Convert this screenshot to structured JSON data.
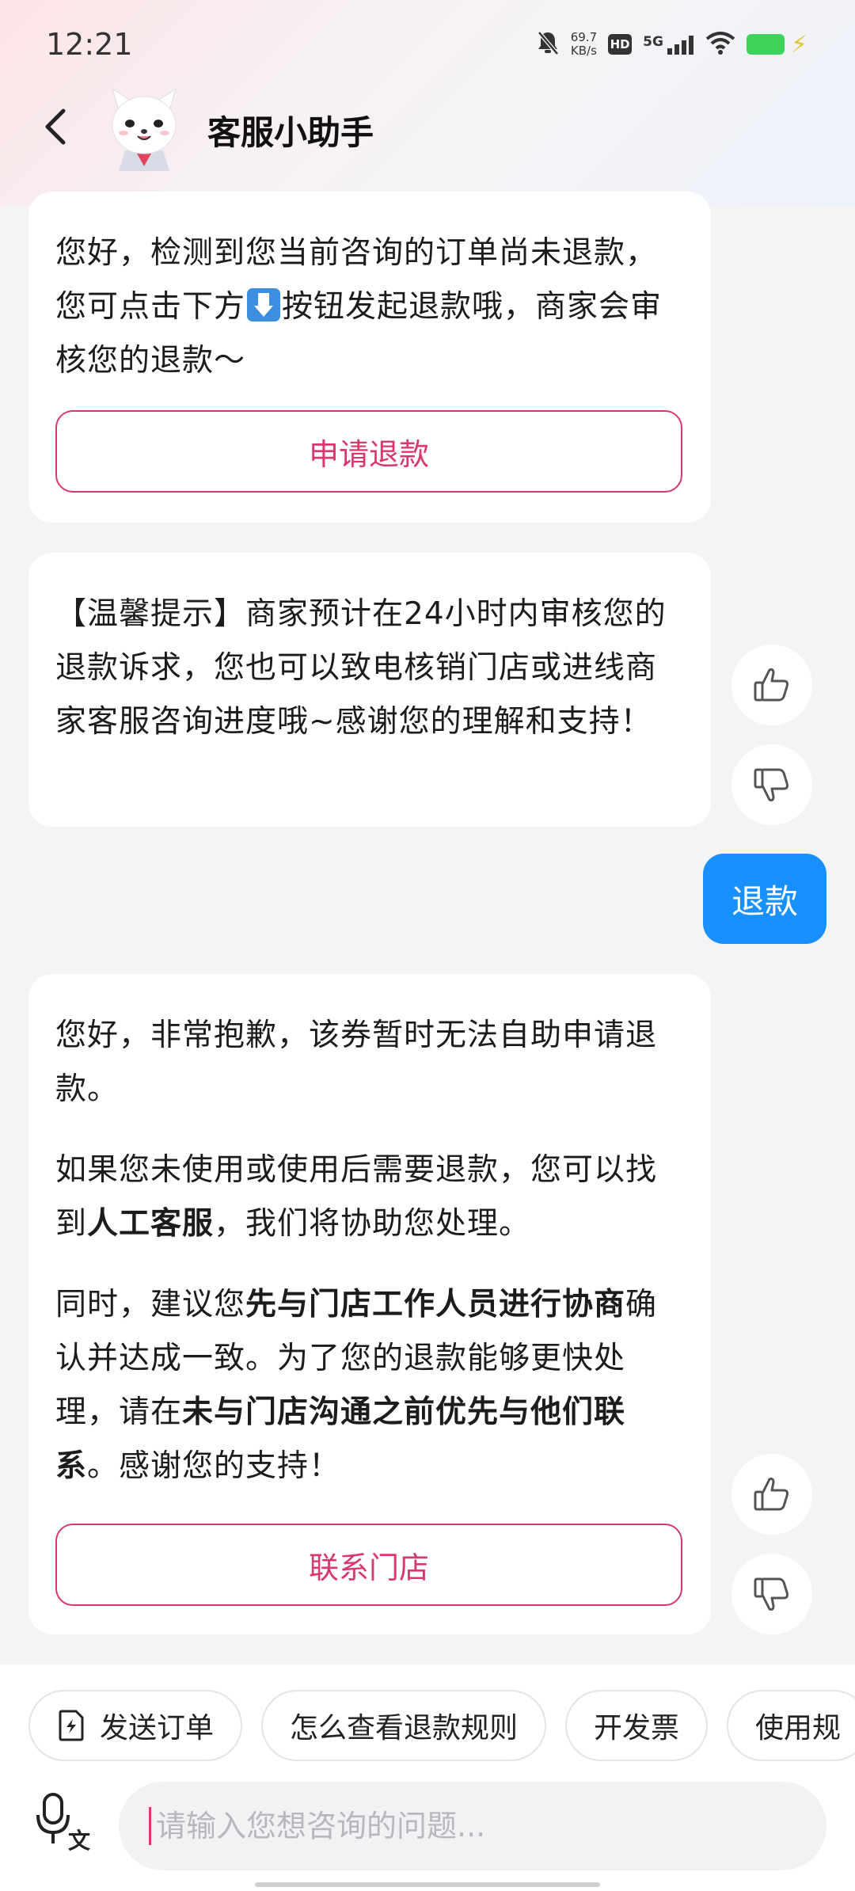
{
  "status_bar": {
    "time": "12:21",
    "net_speed_value": "69.7",
    "net_speed_unit": "KB/s",
    "hd_label": "HD",
    "network_label": "5G"
  },
  "header": {
    "title": "客服小助手"
  },
  "messages": {
    "m1": {
      "text_before_emoji": "您好，检测到您当前咨询的订单尚未退款，您可点击下方",
      "text_after_emoji": "按钮发起退款哦，商家会审核您的退款～",
      "button": "申请退款"
    },
    "m2": {
      "text": "【温馨提示】商家预计在24小时内审核您的退款诉求，您也可以致电核销门店或进线商家客服咨询进度哦~感谢您的理解和支持！"
    },
    "user": {
      "text": "退款"
    },
    "m3": {
      "p1": "您好，非常抱歉，该券暂时无法自助申请退款。",
      "p2_a": "如果您未使用或使用后需要退款，您可以找到",
      "p2_bold": "人工客服",
      "p2_b": "，我们将协助您处理。",
      "p3_a": "同时，建议您",
      "p3_bold1": "先与门店工作人员进行协商",
      "p3_b": "确认并达成一致。为了您的退款能够更快处理，请在",
      "p3_bold2": "未与门店沟通之前优先与他们联系",
      "p3_c": "。感谢您的支持！",
      "button": "联系门店"
    }
  },
  "quick_chips": [
    "发送订单",
    "怎么查看退款规则",
    "开发票",
    "使用规"
  ],
  "input": {
    "placeholder": "请输入您想咨询的问题...",
    "value": ""
  },
  "colors": {
    "accent_pink": "#d8386a",
    "user_bubble": "#1890ff",
    "battery": "#3ed25a"
  }
}
